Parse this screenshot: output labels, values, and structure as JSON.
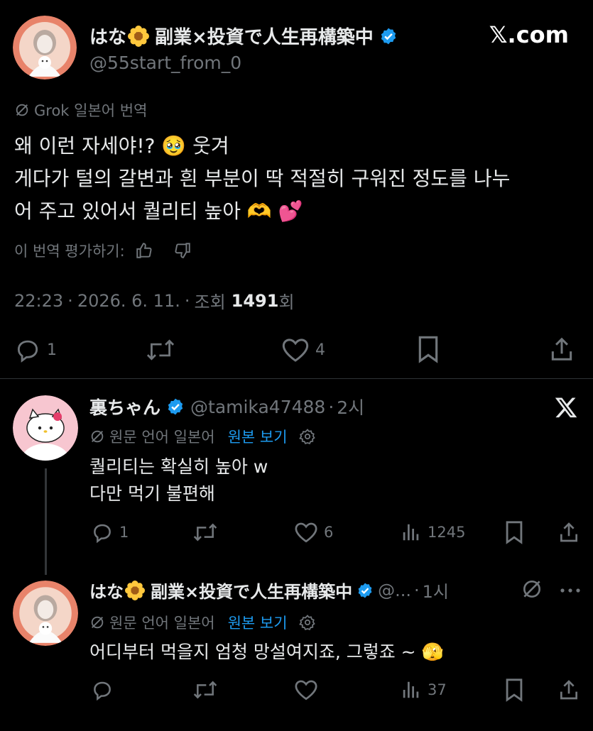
{
  "watermark": "𝕏.com",
  "main_post": {
    "display_name": "はな",
    "display_name_suffix": "副業×投資で人生再構築中",
    "handle": "@55start_from_0",
    "translation_label": "Grok 일본어 번역",
    "text_lines": [
      "왜 이런 자세야!? 🥹 웃겨",
      "게다가 털의 갈변과 흰 부분이 딱 적절히 구워진 정도를 나누",
      "어 주고 있어서 퀄리티 높아 🫶 💕"
    ],
    "rate_translation": "이 번역 평가하기:",
    "time": "22:23",
    "date": "2026. 6. 11.",
    "views_prefix": "조회",
    "views_count": "1491",
    "views_suffix": "회",
    "reply_count": "1",
    "like_count": "4"
  },
  "reply1": {
    "display_name": "裏ちゃん",
    "handle": "@tamika47488",
    "time": "2시",
    "lang_label": "원문 언어 일본어",
    "show_original": "원본 보기",
    "text_lines": [
      "퀄리티는 확실히 높아 w",
      "다만 먹기 불편해"
    ],
    "reply_count": "1",
    "like_count": "6",
    "view_count": "1245"
  },
  "reply2": {
    "display_name": "はな",
    "display_name_suffix": "副業×投資で人生再構築中",
    "handle": "@...",
    "time": "1시",
    "lang_label": "원문 언어 일본어",
    "show_original": "원본 보기",
    "text": "어디부터 먹을지 엄청 망설여지죠, 그렇죠 ~ 🫣",
    "view_count": "37"
  },
  "colors": {
    "background": "#000000",
    "text": "#e7e9ea",
    "muted": "#71767b",
    "accent": "#1d9bf0",
    "divider": "#2f3336"
  }
}
